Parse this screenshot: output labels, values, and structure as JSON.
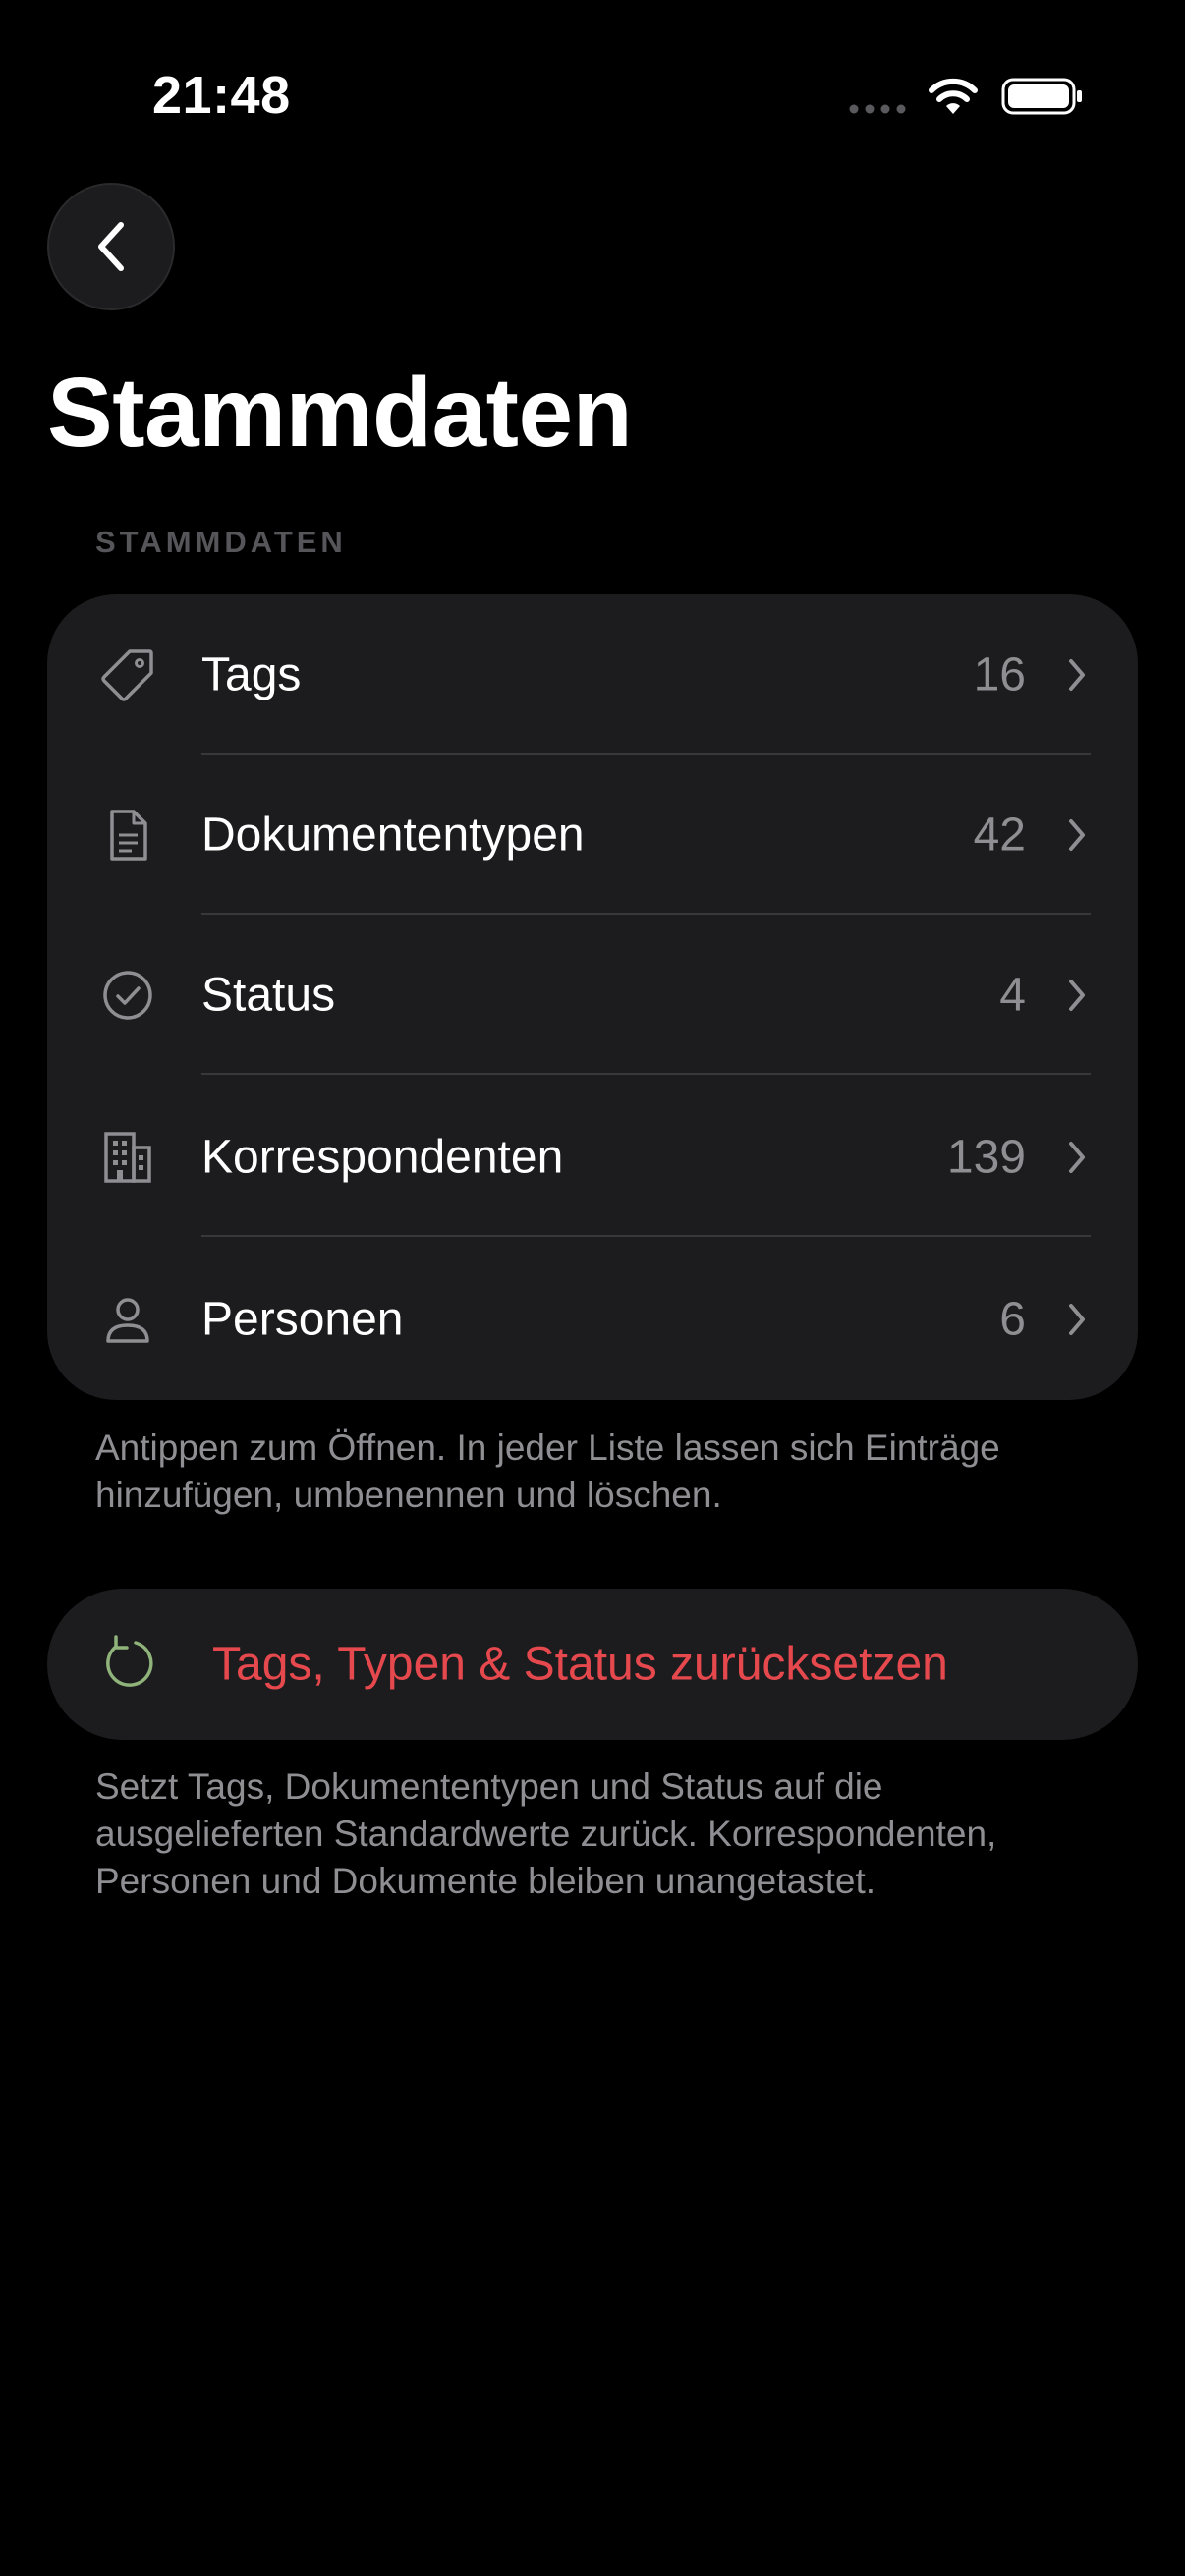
{
  "status_bar": {
    "time": "21:48"
  },
  "navigation": {
    "back_icon": "chevron-left-icon"
  },
  "page": {
    "title": "Stammdaten",
    "section_header": "STAMMDATEN"
  },
  "list": {
    "items": [
      {
        "label": "Tags",
        "count": "16",
        "icon": "tag-icon"
      },
      {
        "label": "Dokumententypen",
        "count": "42",
        "icon": "document-icon"
      },
      {
        "label": "Status",
        "count": "4",
        "icon": "checkmark-circle-icon"
      },
      {
        "label": "Korrespondenten",
        "count": "139",
        "icon": "building-icon"
      },
      {
        "label": "Personen",
        "count": "6",
        "icon": "person-icon"
      }
    ],
    "footer": "Antippen zum Öffnen. In jeder Liste lassen sich Einträge hinzufügen, umbenennen und löschen."
  },
  "reset": {
    "label": "Tags, Typen & Status zurücksetzen",
    "icon": "reset-arrow-icon",
    "footer": "Setzt Tags, Dokumententypen und Status auf die ausgelieferten Standardwerte zurück. Korrespondenten, Personen und Dokumente bleiben unangetastet."
  },
  "colors": {
    "background": "#000000",
    "card": "#1c1c1e",
    "secondary_text": "#8e8e93",
    "destructive": "#e5484d",
    "reset_icon": "#8fb37a"
  }
}
